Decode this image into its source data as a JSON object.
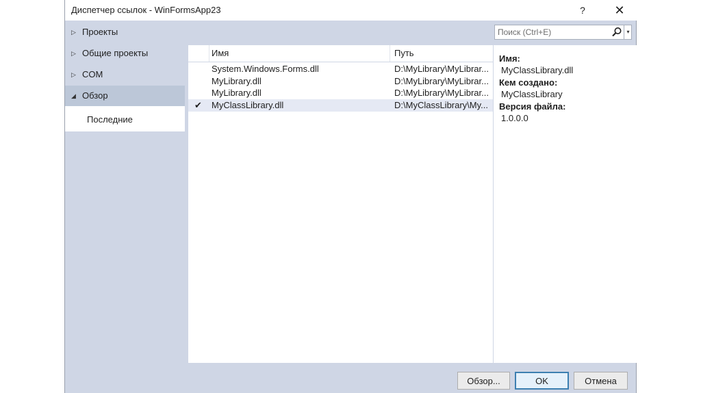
{
  "window": {
    "title": "Диспетчер ссылок - WinFormsApp23",
    "help_glyph": "?",
    "close_glyph": "✕"
  },
  "nav": {
    "items": [
      {
        "label": "Проекты",
        "arrow": "▷",
        "expanded": false
      },
      {
        "label": "Общие проекты",
        "arrow": "▷",
        "expanded": false
      },
      {
        "label": "COM",
        "arrow": "▷",
        "expanded": false
      },
      {
        "label": "Обзор",
        "arrow": "◢",
        "expanded": true,
        "selected": true
      }
    ],
    "subitem": {
      "label": "Последние"
    }
  },
  "search": {
    "placeholder": "Поиск (Ctrl+E)",
    "icon": "search-icon",
    "dropdown_glyph": "▾"
  },
  "list": {
    "columns": {
      "name": "Имя",
      "path": "Путь"
    },
    "rows": [
      {
        "name": "System.Windows.Forms.dll",
        "path": "D:\\MyLibrary\\MyLibrar...",
        "checked": false
      },
      {
        "name": "MyLibrary.dll",
        "path": "D:\\MyLibrary\\MyLibrar...",
        "checked": false
      },
      {
        "name": "MyLibrary.dll",
        "path": "D:\\MyLibrary\\MyLibrar...",
        "checked": false
      },
      {
        "name": "MyClassLibrary.dll",
        "path": "D:\\MyClassLibrary\\My...",
        "checked": true,
        "selected": true
      }
    ],
    "check_glyph": "✔"
  },
  "details": {
    "name_label": "Имя:",
    "name_value": "MyClassLibrary.dll",
    "author_label": "Кем создано:",
    "author_value": "MyClassLibrary",
    "version_label": "Версия файла:",
    "version_value": "1.0.0.0"
  },
  "footer": {
    "browse_label": "Обзор...",
    "ok_label": "OK",
    "cancel_label": "Отмена"
  },
  "colors": {
    "dialog_background": "#cfd6e5",
    "nav_selected": "#bcc7d8",
    "row_selected": "#e5e9f4",
    "ok_border": "#3c7fb1"
  }
}
